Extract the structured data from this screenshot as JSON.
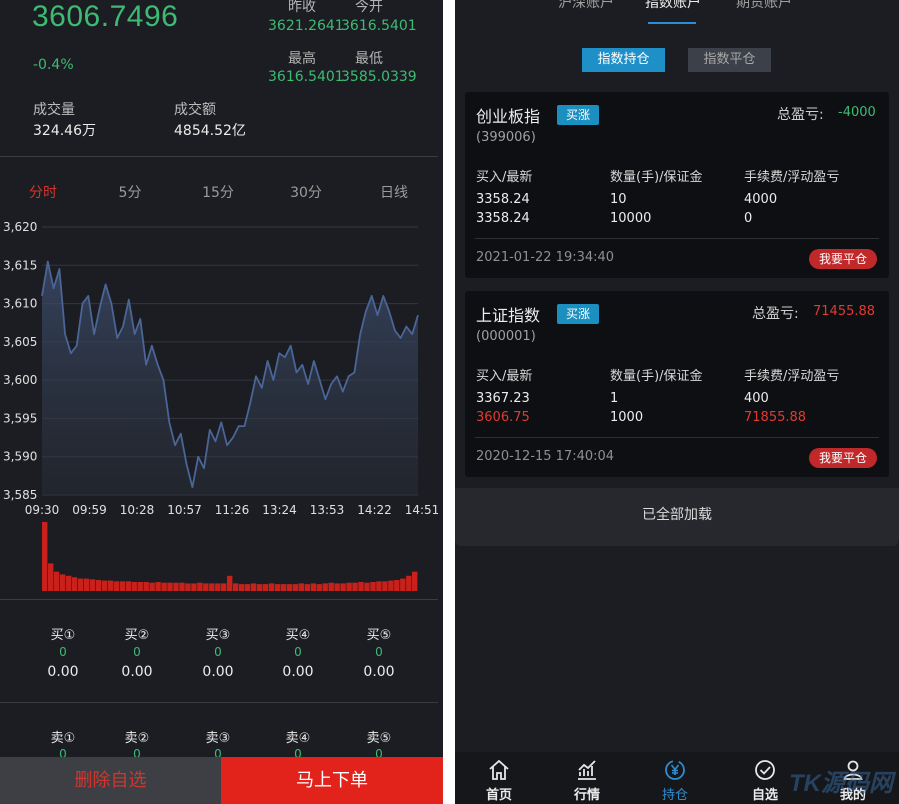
{
  "quote": {
    "price": "3606.7496",
    "change": "-0.4%",
    "prev_close_label": "昨收",
    "prev_close": "3621.2641",
    "open_label": "今开",
    "open": "3616.5401",
    "high_label": "最高",
    "high": "3616.5401",
    "low_label": "最低",
    "low": "3585.0339",
    "volume_label": "成交量",
    "volume": "324.46万",
    "turnover_label": "成交额",
    "turnover": "4854.52亿",
    "price_color": "#3dbb73"
  },
  "periods": [
    "分时",
    "5分",
    "15分",
    "30分",
    "日线"
  ],
  "active_period": "分时",
  "chart_data": {
    "type": "line",
    "title": "",
    "xlabel": "",
    "ylabel": "",
    "x_ticks": [
      "09:30",
      "09:59",
      "10:28",
      "10:57",
      "11:26",
      "13:24",
      "13:53",
      "14:22",
      "14:51"
    ],
    "y_ticks": [
      "3,585",
      "3,590",
      "3,595",
      "3,600",
      "3,605",
      "3,610",
      "3,615",
      "3,620"
    ],
    "ylim": [
      3585,
      3620
    ],
    "grid": true,
    "series": [
      {
        "values": [
          3611.0,
          3615.5,
          3612.0,
          3614.5,
          3606.0,
          3603.5,
          3604.5,
          3610.0,
          3611.0,
          3606.0,
          3609.5,
          3612.5,
          3610.0,
          3605.5,
          3607.0,
          3610.5,
          3606.0,
          3608.0,
          3602.0,
          3604.5,
          3602.0,
          3600.0,
          3594.5,
          3591.5,
          3593.0,
          3589.0,
          3586.0,
          3590.0,
          3588.5,
          3593.5,
          3592.0,
          3594.5,
          3591.5,
          3592.5,
          3594.0,
          3594.0,
          3597.0,
          3600.5,
          3599.0,
          3602.5,
          3600.0,
          3603.5,
          3603.0,
          3604.5,
          3601.0,
          3602.0,
          3599.5,
          3602.5,
          3600.0,
          3597.5,
          3599.5,
          3600.5,
          3598.5,
          3600.5,
          3601.0,
          3606.0,
          3609.0,
          3611.0,
          3608.5,
          3611.0,
          3609.0,
          3606.5,
          3605.5,
          3607.0,
          3606.0,
          3608.5
        ]
      }
    ],
    "volume_values": [
      100,
      40,
      28,
      24,
      22,
      20,
      18,
      18,
      17,
      16,
      15,
      15,
      14,
      14,
      14,
      13,
      13,
      13,
      12,
      13,
      12,
      12,
      12,
      12,
      11,
      11,
      12,
      11,
      11,
      11,
      11,
      22,
      11,
      10,
      10,
      11,
      10,
      10,
      11,
      10,
      10,
      10,
      10,
      11,
      10,
      11,
      10,
      11,
      12,
      11,
      11,
      12,
      12,
      13,
      12,
      13,
      14,
      14,
      15,
      16,
      18,
      22,
      28
    ],
    "line_color": "#4a6596",
    "volume_color": "#c8201a"
  },
  "orderbook": {
    "buy": [
      {
        "label": "买①",
        "qty": "0",
        "price": "0.00"
      },
      {
        "label": "买②",
        "qty": "0",
        "price": "0.00"
      },
      {
        "label": "买③",
        "qty": "0",
        "price": "0.00"
      },
      {
        "label": "买④",
        "qty": "0",
        "price": "0.00"
      },
      {
        "label": "买⑤",
        "qty": "0",
        "price": "0.00"
      }
    ],
    "sell": [
      {
        "label": "卖①",
        "qty": "0"
      },
      {
        "label": "卖②",
        "qty": "0"
      },
      {
        "label": "卖③",
        "qty": "0"
      },
      {
        "label": "卖④",
        "qty": "0"
      },
      {
        "label": "卖⑤",
        "qty": "0"
      }
    ]
  },
  "actions": {
    "remove_watch": "删除自选",
    "order_now": "马上下单"
  },
  "account_tabs": [
    "沪深账户",
    "指数账户",
    "期货账户"
  ],
  "active_account_tab": "指数账户",
  "sub_tabs": {
    "holding": "指数持仓",
    "closed": "指数平仓"
  },
  "positions": [
    {
      "name": "创业板指",
      "tag": "买涨",
      "code": "(399006)",
      "total_pl_label": "总盈亏:",
      "total_pl": "-4000",
      "total_pl_color": "#3dbb73",
      "col1_header": "买入/最新",
      "col2_header": "数量(手)/保证金",
      "col3_header": "手续费/浮动盈亏",
      "buy_price": "3358.24",
      "latest_price": "3358.24",
      "quantity": "10",
      "margin": "10000",
      "fee": "4000",
      "floating_pl": "0",
      "time": "2021-01-22 19:34:40",
      "close_label": "我要平仓"
    },
    {
      "name": "上证指数",
      "tag": "买涨",
      "code": "(000001)",
      "total_pl_label": "总盈亏:",
      "total_pl": "71455.88",
      "total_pl_color": "#e03a30",
      "col1_header": "买入/最新",
      "col2_header": "数量(手)/保证金",
      "col3_header": "手续费/浮动盈亏",
      "buy_price": "3367.23",
      "latest_price": "3606.75",
      "quantity": "1",
      "margin": "1000",
      "fee": "400",
      "floating_pl": "71855.88",
      "time": "2020-12-15 17:40:04",
      "close_label": "我要平仓"
    }
  ],
  "all_loaded": "已全部加载",
  "nav": [
    {
      "label": "首页",
      "icon": "home-icon"
    },
    {
      "label": "行情",
      "icon": "chart-icon"
    },
    {
      "label": "持仓",
      "icon": "yuan-coin-icon"
    },
    {
      "label": "自选",
      "icon": "check-circle-icon"
    },
    {
      "label": "我的",
      "icon": "user-icon"
    }
  ],
  "active_nav": "持仓",
  "watermark": "TK源码网"
}
